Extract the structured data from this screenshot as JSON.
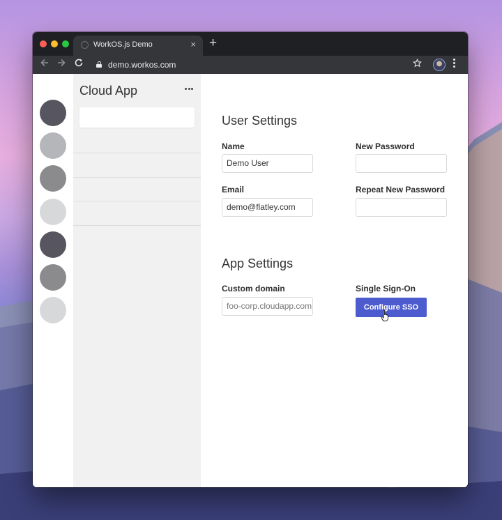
{
  "browser": {
    "tab_title": "WorkOS.js Demo",
    "tab_close": "×",
    "new_tab": "+",
    "url": "demo.workos.com",
    "icons": [
      "back-arrow-icon",
      "forward-arrow-icon",
      "reload-icon",
      "lock-icon",
      "star-icon",
      "profile-avatar",
      "more-vert-icon"
    ]
  },
  "sidebar": {
    "title": "Cloud App",
    "app_colors": [
      "#57555f",
      "#b5b6b9",
      "#8b8b8d",
      "#d7d8da",
      "#57555f",
      "#8b8b8d",
      "#d7d8da"
    ]
  },
  "user_settings": {
    "title": "User Settings",
    "name_label": "Name",
    "name_value": "Demo User",
    "email_label": "Email",
    "email_value": "demo@flatley.com",
    "new_password_label": "New Password",
    "new_password_value": "",
    "repeat_password_label": "Repeat New Password",
    "repeat_password_value": ""
  },
  "app_settings": {
    "title": "App Settings",
    "domain_label": "Custom domain",
    "domain_value": "foo-corp.cloudapp.com",
    "sso_label": "Single Sign-On",
    "sso_button": "Configure SSO"
  },
  "colors": {
    "accent": "#4c5bce"
  }
}
